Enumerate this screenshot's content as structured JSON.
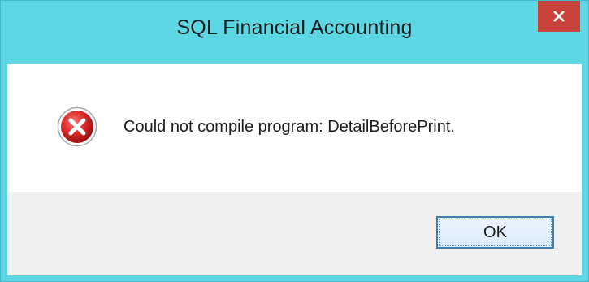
{
  "window": {
    "title": "SQL Financial Accounting",
    "close_icon": "close-icon"
  },
  "message": {
    "icon": "error-icon",
    "text": "Could not compile program: DetailBeforePrint."
  },
  "buttons": {
    "ok_label": "OK"
  },
  "colors": {
    "frame": "#5dd7e3",
    "close_button": "#c9433c",
    "button_area": "#f0f0f0",
    "ok_border": "#3c7fb1",
    "error_red": "#d92a2a"
  }
}
